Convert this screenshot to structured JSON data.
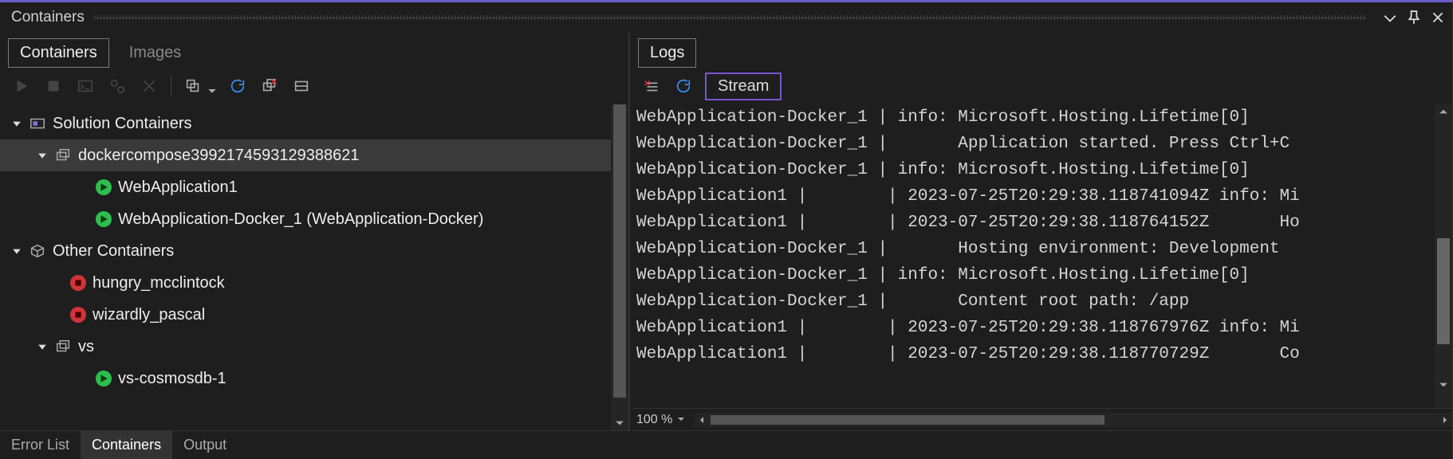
{
  "window": {
    "title": "Containers"
  },
  "left": {
    "tabs": {
      "containers": "Containers",
      "images": "Images"
    },
    "tree": {
      "solution_header": "Solution Containers",
      "compose_group": "dockercompose3992174593129388621",
      "webapp1": "WebApplication1",
      "webapp_docker": "WebApplication-Docker_1 (WebApplication-Docker)",
      "other_header": "Other Containers",
      "hungry": "hungry_mcclintock",
      "wizardly": "wizardly_pascal",
      "vs_group": "vs",
      "vs_cosmos": "vs-cosmosdb-1"
    }
  },
  "right": {
    "tabs": {
      "logs": "Logs"
    },
    "stream": "Stream",
    "logs": [
      "WebApplication-Docker_1 | info: Microsoft.Hosting.Lifetime[0]",
      "WebApplication-Docker_1 |       Application started. Press Ctrl+C",
      "WebApplication-Docker_1 | info: Microsoft.Hosting.Lifetime[0]",
      "WebApplication1 |        | 2023-07-25T20:29:38.118741094Z info: Mi",
      "WebApplication1 |        | 2023-07-25T20:29:38.118764152Z       Ho",
      "WebApplication-Docker_1 |       Hosting environment: Development",
      "WebApplication-Docker_1 | info: Microsoft.Hosting.Lifetime[0]",
      "WebApplication-Docker_1 |       Content root path: /app",
      "WebApplication1 |        | 2023-07-25T20:29:38.118767976Z info: Mi",
      "WebApplication1 |        | 2023-07-25T20:29:38.118770729Z       Co"
    ],
    "zoom": "100 %"
  },
  "status": {
    "error_list": "Error List",
    "containers": "Containers",
    "output": "Output"
  }
}
